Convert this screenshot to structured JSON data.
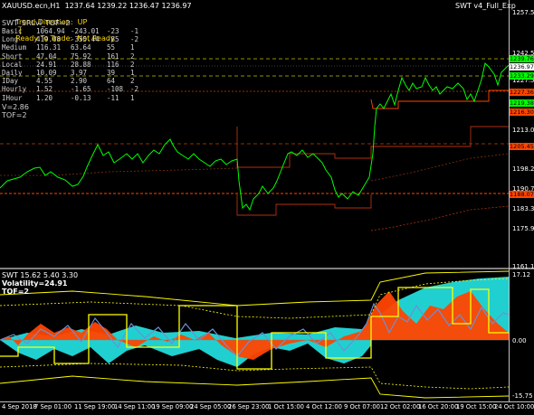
{
  "header": {
    "symbol_line": "XAUUSD.ecn,H1  1237.64 1239.22 1236.47 1236.97",
    "status_line": {
      "trend": "Trend Direction:  UP",
      "sep1": "|",
      "ready": "Ready To Trade:  Not Ready"
    },
    "ea_name": "SWT v4_Full_Exp",
    "indicator_name": "SWT_SRLvl_TOF=2"
  },
  "levels_table": [
    {
      "name": "Basic",
      "a": "1064.94",
      "b": "-243.01",
      "c": "-23",
      "d": "-1"
    },
    {
      "name": "Long",
      "a": "419.08",
      "b": "-355.44",
      "c": "-85",
      "d": "-2"
    },
    {
      "name": "Medium",
      "a": "116.31",
      "b": "63.64",
      "c": "55",
      "d": "1"
    },
    {
      "name": "Short",
      "a": "47.04",
      "b": "75.92",
      "c": "161",
      "d": "2"
    },
    {
      "name": "Local",
      "a": "24.91",
      "b": "28.88",
      "c": "116",
      "d": "2"
    },
    {
      "name": "Daily",
      "a": "10.09",
      "b": "3.97",
      "c": "39",
      "d": "1"
    },
    {
      "name": "IDay",
      "a": "4.55",
      "b": "2.90",
      "c": "64",
      "d": "2"
    },
    {
      "name": "Hourly",
      "a": "1.52",
      "b": "-1.65",
      "c": "-108",
      "d": "-2"
    },
    {
      "name": "IHour",
      "a": "1.20",
      "b": "-0.13",
      "c": "-11",
      "d": "1"
    }
  ],
  "v_line": "V=2.86",
  "tof_line": "TOF=2",
  "price_axis": [
    "1257.50",
    "1242.50",
    "1227.50",
    "1213.00",
    "1198.25",
    "1190.70",
    "1183.30",
    "1175.90",
    "1161.10"
  ],
  "price_tags": [
    {
      "text": "1239.76",
      "bg": "#00ff00"
    },
    {
      "text": "1236.97",
      "bg": "#ffffff"
    },
    {
      "text": "1233.29",
      "bg": "#00ff00"
    },
    {
      "text": "1227.36",
      "bg": "#ff4500"
    },
    {
      "text": "1219.38",
      "bg": "#00ff00"
    },
    {
      "text": "1216.30",
      "bg": "#ff4500"
    },
    {
      "text": "1205.45",
      "bg": "#ff4500"
    },
    {
      "text": "1188.07",
      "bg": "#ff4500"
    }
  ],
  "subwindow": {
    "title": "SWT 15.62 5.40 3.30",
    "volatility": "Volatility=24.91",
    "tof": "TOF=2",
    "axis": [
      "17.12",
      "0.00",
      "-15.75"
    ]
  },
  "time_axis": [
    "4 Sep 2018",
    "7 Sep 01:00",
    "11 Sep 19:00",
    "14 Sep 11:00",
    "19 Sep 09:00",
    "24 Sep 05:00",
    "26 Sep 23:00",
    "1 Oct 15:00",
    "4 Oct 12:00",
    "9 Oct 07:00",
    "12 Oct 02:00",
    "16 Oct 20:00",
    "19 Oct 15:00",
    "24 Oct 10:00"
  ],
  "colors": {
    "price": "#00ff00",
    "resistance": "#ff4500",
    "dashed": "#ffd700",
    "hist_orange": "#ff4500",
    "hist_cyan": "#20d0d0",
    "hist_blue": "#6f8fd0",
    "band": "#ffff00"
  }
}
